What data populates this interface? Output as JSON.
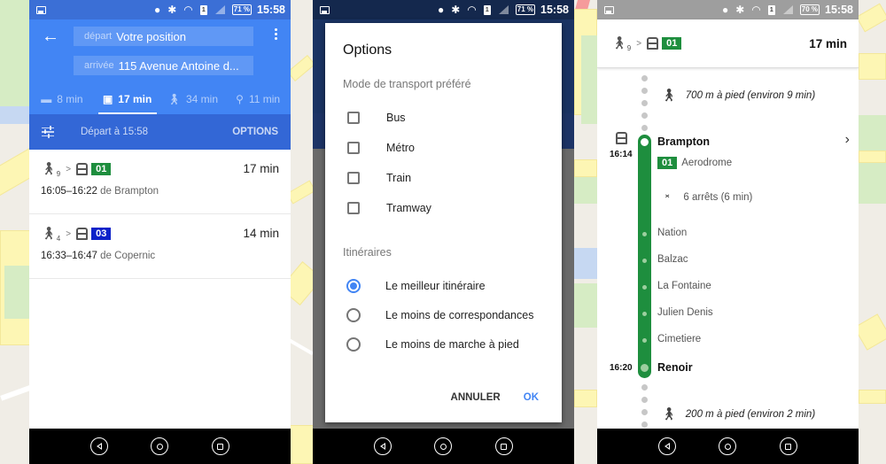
{
  "colors": {
    "blue_primary": "#4285f4",
    "blue_dark": "#3367d6",
    "line_01": "#1e8e3e",
    "line_03": "#0d22c9"
  },
  "status": {
    "phone1": {
      "battery": "71 %",
      "time": "15:58",
      "sim": "1"
    },
    "phone2": {
      "battery": "71 %",
      "time": "15:58",
      "sim": "1"
    },
    "phone3": {
      "battery": "70 %",
      "time": "15:58",
      "sim": "1"
    }
  },
  "directions": {
    "back_icon": "arrow-left-icon",
    "depart_label": "départ",
    "depart_value": "Votre position",
    "arrivee_label": "arrivée",
    "arrivee_value": "115 Avenue Antoine d...",
    "modes": [
      {
        "icon": "car-icon",
        "glyph": "🚘",
        "label": "8 min",
        "active": false
      },
      {
        "icon": "transit-icon",
        "glyph": "🚆",
        "label": "17 min",
        "active": true
      },
      {
        "icon": "walk-icon",
        "glyph": "🚶",
        "label": "34 min",
        "active": false
      },
      {
        "icon": "bike-icon",
        "glyph": "🚲",
        "label": "11 min",
        "active": false
      }
    ],
    "depart_time": "Départ à 15:58",
    "options_label": "OPTIONS",
    "routes": [
      {
        "walk_minutes": "9",
        "line": "01",
        "duration": "17 min",
        "times": "16:05–16:22",
        "from": "de Brampton"
      },
      {
        "walk_minutes": "4",
        "line": "03",
        "duration": "14 min",
        "times": "16:33–16:47",
        "from": "de Copernic"
      }
    ]
  },
  "options_dialog": {
    "title": "Options",
    "mode_section": "Mode de transport préféré",
    "modes": [
      {
        "label": "Bus",
        "checked": false
      },
      {
        "label": "Métro",
        "checked": false
      },
      {
        "label": "Train",
        "checked": false
      },
      {
        "label": "Tramway",
        "checked": false
      }
    ],
    "itinerary_section": "Itinéraires",
    "itineraries": [
      {
        "label": "Le meilleur itinéraire",
        "selected": true
      },
      {
        "label": "Le moins de correspondances",
        "selected": false
      },
      {
        "label": "Le moins de marche à pied",
        "selected": false
      }
    ],
    "cancel_label": "ANNULER",
    "ok_label": "OK"
  },
  "route_detail": {
    "walk_minutes": "9",
    "line": "01",
    "duration": "17 min",
    "walk_start": "700 m à pied (environ 9 min)",
    "board_time": "16:14",
    "board_stop": "Brampton",
    "direction": "Aerodrome",
    "stops_summary": "6 arrêts (6 min)",
    "intermediate_stops": [
      "Nation",
      "Balzac",
      "La Fontaine",
      "Julien Denis",
      "Cimetiere"
    ],
    "alight_time": "16:20",
    "alight_stop": "Renoir",
    "walk_end": "200 m à pied (environ 2 min)"
  }
}
